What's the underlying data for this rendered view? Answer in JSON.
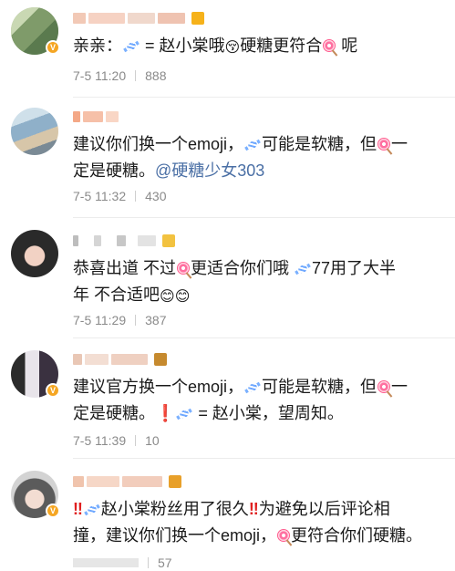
{
  "comments": [
    {
      "text_parts": [
        "亲亲",
        "：",
        " = 赵小棠哦",
        "硬糖更符合",
        " 呢"
      ],
      "time": "7-5 11:20",
      "likes": "888"
    },
    {
      "line1": [
        "建议你们换一个emoji，",
        "可能是软糖，但",
        "一"
      ],
      "line2_prefix": "定是硬糖。",
      "mention": "@硬糖少女303",
      "time": "7-5 11:32",
      "likes": "430"
    },
    {
      "line1": [
        "恭喜出道  不过",
        "更适合你们哦 ",
        "77用了大半"
      ],
      "line2": "年 不合适吧",
      "time": "7-5 11:29",
      "likes": "387"
    },
    {
      "line1": [
        "建议官方换一个emoji，",
        "可能是软糖，但",
        "一"
      ],
      "line2": [
        "定是硬糖。",
        " = 赵小棠，望周知。"
      ],
      "time": "7-5 11:39",
      "likes": "10"
    },
    {
      "line1": [
        "赵小棠粉丝用了很久",
        "为避免以后评论相"
      ],
      "line2": [
        "撞，建议你们换一个emoji，",
        "更符合你们硬糖。"
      ],
      "time": "",
      "likes": "57"
    }
  ],
  "icons": {
    "candy": "candy-emoji-icon",
    "lollipop": "lollipop-emoji-icon",
    "kiss": "kiss-emoji-icon",
    "blush": "blush-emoji-icon",
    "double_exclamation": "double-exclamation-icon",
    "exclamation": "exclamation-icon"
  },
  "colors": {
    "mention": "#4a6fa5",
    "meta": "#8a8a8a",
    "badge": "#f5a623"
  }
}
